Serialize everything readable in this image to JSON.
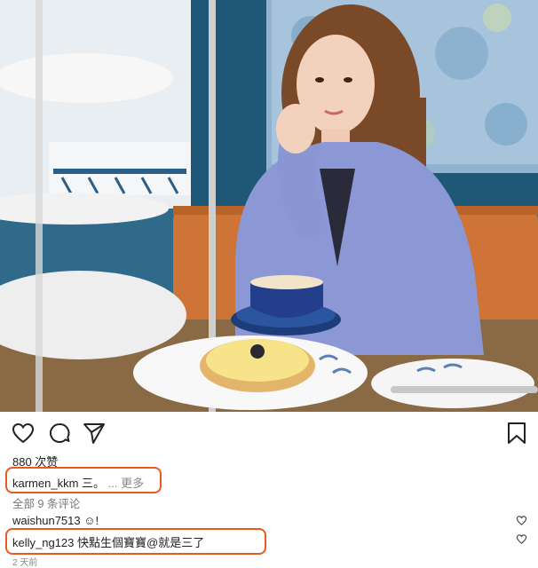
{
  "post": {
    "likes": "880 次赞",
    "caption": {
      "user": "karmen_kkm",
      "text": "三。",
      "more": "... 更多"
    },
    "view_all_comments": "全部 9 条评论",
    "comments": [
      {
        "user": "waishun7513",
        "text": "☺!"
      },
      {
        "user": "kelly_ng123",
        "text": "快點生個寶寶@就是三了"
      }
    ],
    "time_ago": "2 天前"
  },
  "icons": {
    "like": "heart-icon",
    "comment": "comment-bubble-icon",
    "share": "paper-plane-icon",
    "save": "bookmark-icon"
  },
  "colors": {
    "highlight": "#e85a1f"
  }
}
